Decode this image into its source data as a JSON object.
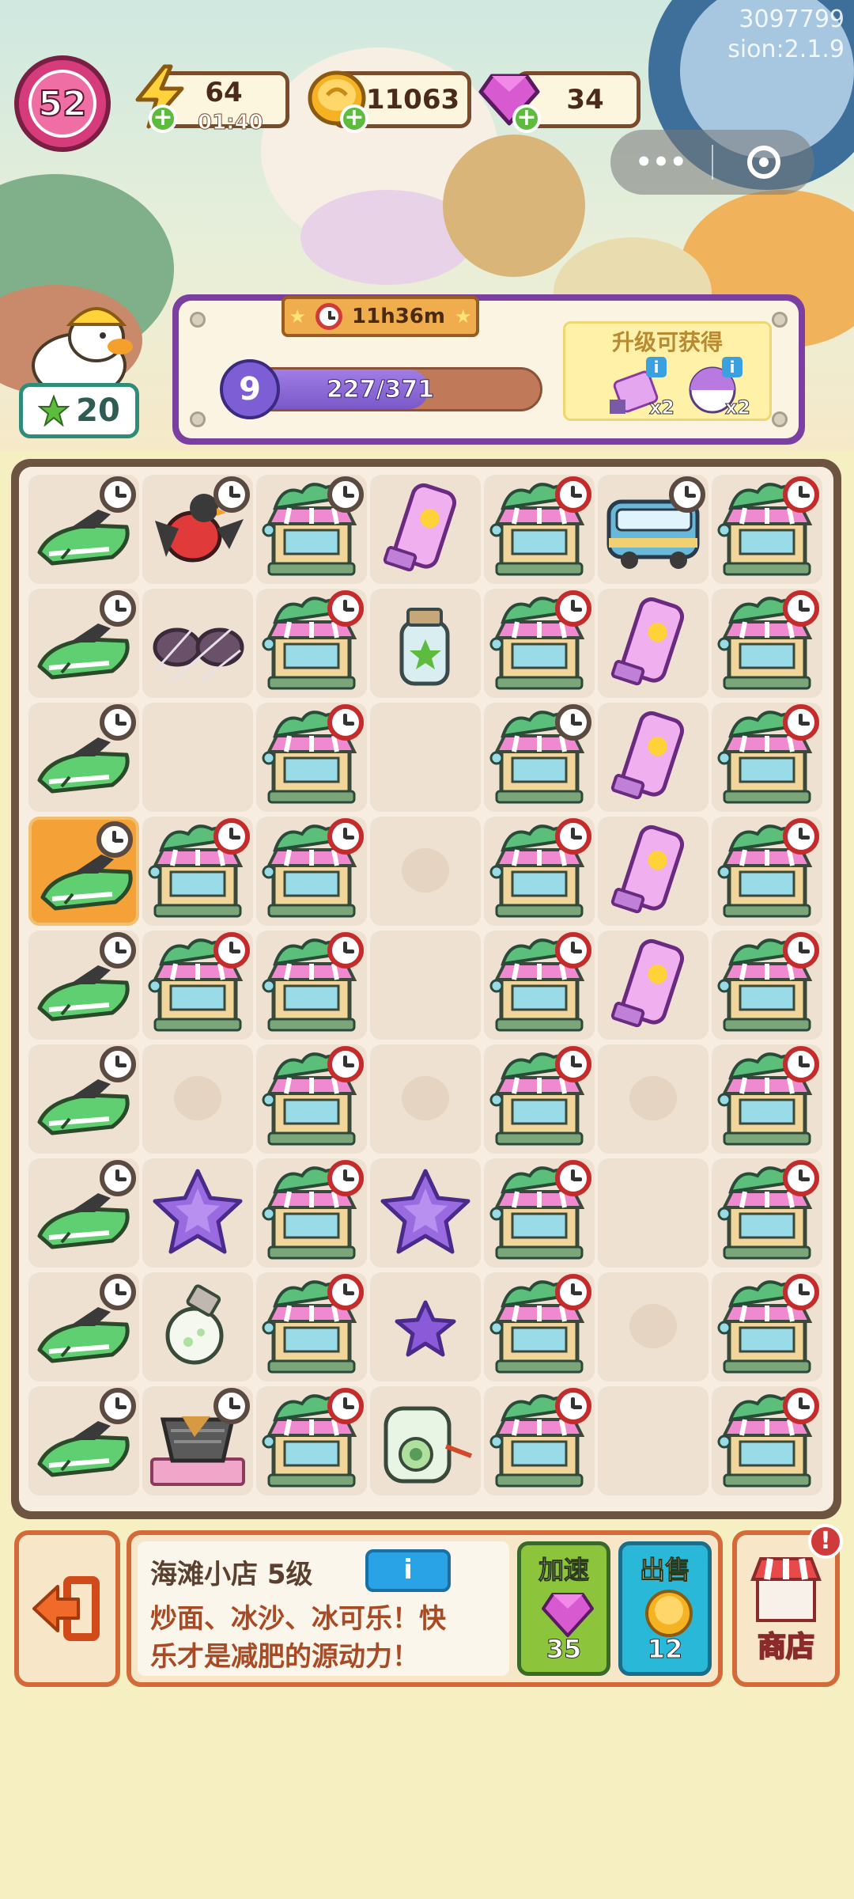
{
  "watermark": {
    "line1": "3097799",
    "line2": "sion:2.1.9"
  },
  "player": {
    "level": "52"
  },
  "resources": {
    "energy": {
      "value": "64",
      "timer": "01:40"
    },
    "coins": {
      "value": "11063"
    },
    "gems": {
      "value": "34"
    }
  },
  "avatar": {
    "count": "20"
  },
  "upgrade": {
    "timer": "11h36m",
    "level": "9",
    "progress_text": "227/371",
    "progress_current": 227,
    "progress_max": 371,
    "reward_title": "升级可获得",
    "rewards": [
      {
        "icon": "pink-bag-icon",
        "qty": "x2"
      },
      {
        "icon": "beach-ball-icon",
        "qty": "x2"
      }
    ]
  },
  "board": {
    "columns": 7,
    "rows": [
      [
        "jetski:timer-dark",
        "bird:timer-dark",
        "shop:timer-dark",
        "sunscreen",
        "shop:timer",
        "bus:timer-dark",
        "shop:timer"
      ],
      [
        "jetski:timer-dark",
        "web-glasses",
        "shop:timer",
        "jar",
        "shop:timer",
        "sunscreen",
        "shop:timer"
      ],
      [
        "jetski:timer-dark",
        "empty",
        "shop:timer",
        "empty",
        "shop:timer-dark",
        "sunscreen",
        "shop:timer"
      ],
      [
        "jetski-selected:timer-dark",
        "shop:timer",
        "shop:timer",
        "cloud",
        "shop:timer",
        "sunscreen",
        "shop:timer"
      ],
      [
        "jetski:timer-dark",
        "shop:timer",
        "shop:timer",
        "empty",
        "shop:timer",
        "sunscreen",
        "shop:timer"
      ],
      [
        "jetski:timer-dark",
        "cloud",
        "shop:timer",
        "cloud",
        "shop:timer",
        "cloud",
        "shop:timer"
      ],
      [
        "jetski:timer-dark",
        "star",
        "shop:timer",
        "star",
        "shop:timer",
        "empty",
        "shop:timer"
      ],
      [
        "jetski:timer-dark",
        "bulb",
        "shop:timer",
        "star-small",
        "shop:timer",
        "cloud",
        "shop:timer"
      ],
      [
        "jetski:timer-dark",
        "grill:timer-dark",
        "shop:timer",
        "camera",
        "shop:timer",
        "empty",
        "shop:timer"
      ]
    ]
  },
  "selected_item": {
    "name": "海滩小店 5级",
    "info_label": "i",
    "description_line1": "炒面、冰沙、冰可乐！快",
    "description_line2": "乐才是减肥的源动力！"
  },
  "actions": {
    "speed_label": "加速",
    "speed_cost": "35",
    "sell_label": "出售",
    "sell_value": "12",
    "shop_label": "商店",
    "shop_alert": "!"
  },
  "colors": {
    "accent_purple": "#7a3fa0",
    "board_frame": "#6d5440",
    "panel_border": "#d46a38",
    "timer_red": "#c42c2c"
  }
}
